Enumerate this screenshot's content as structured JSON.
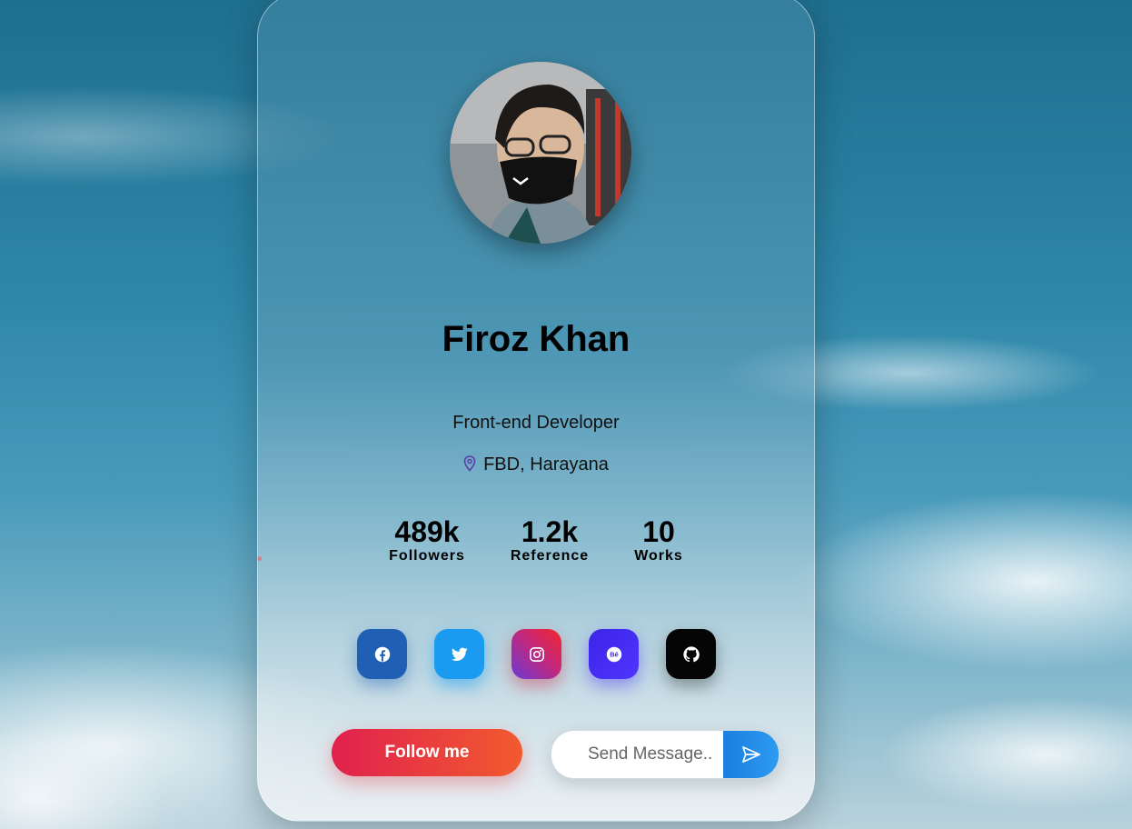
{
  "profile": {
    "name": "Firoz Khan",
    "role": "Front-end Developer",
    "location": "FBD, Harayana"
  },
  "stats": [
    {
      "value": "489k",
      "label": "Followers"
    },
    {
      "value": "1.2k",
      "label": "Reference"
    },
    {
      "value": "10",
      "label": "Works"
    }
  ],
  "social": [
    {
      "name": "facebook",
      "icon": "facebook-icon",
      "color": "#1f5fb4"
    },
    {
      "name": "twitter",
      "icon": "twitter-icon",
      "color": "#1a9bf0"
    },
    {
      "name": "instagram",
      "icon": "instagram-icon",
      "color": "#c4277a"
    },
    {
      "name": "behance",
      "icon": "behance-icon",
      "color": "#3b25e6"
    },
    {
      "name": "github",
      "icon": "github-icon",
      "color": "#050505"
    }
  ],
  "actions": {
    "follow_label": "Follow me",
    "message_placeholder": "Send Message.."
  },
  "colors": {
    "follow_gradient_start": "#e0214e",
    "follow_gradient_end": "#f25a2e",
    "send_button": "#1a7fe0"
  }
}
